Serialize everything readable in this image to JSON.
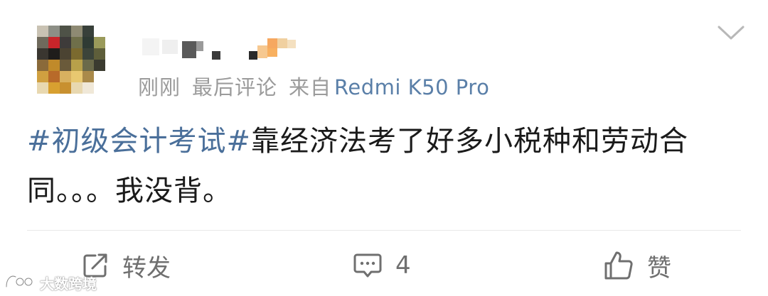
{
  "post": {
    "time": "刚刚",
    "status": "最后评论",
    "source_prefix": "来自",
    "device": "Redmi K50 Pro",
    "topic": "#初级会计考试#",
    "body": "靠经济法考了好多小税种和劳动合同。。。我没背。"
  },
  "actions": {
    "repost_label": "转发",
    "comment_count": "4",
    "like_label": "赞"
  },
  "watermark": {
    "text": "大数跨境"
  },
  "icons": {
    "more": "chevron-down-icon",
    "repost": "repost-icon",
    "comment": "comment-icon",
    "like": "thumbs-up-icon",
    "watermark_logo": "brand-logo-icon"
  },
  "colors": {
    "topic_link": "#4a6f9a",
    "meta_text": "#9b9b9b",
    "device_link": "#5a7fa8",
    "action_text": "#6f6f6f"
  }
}
